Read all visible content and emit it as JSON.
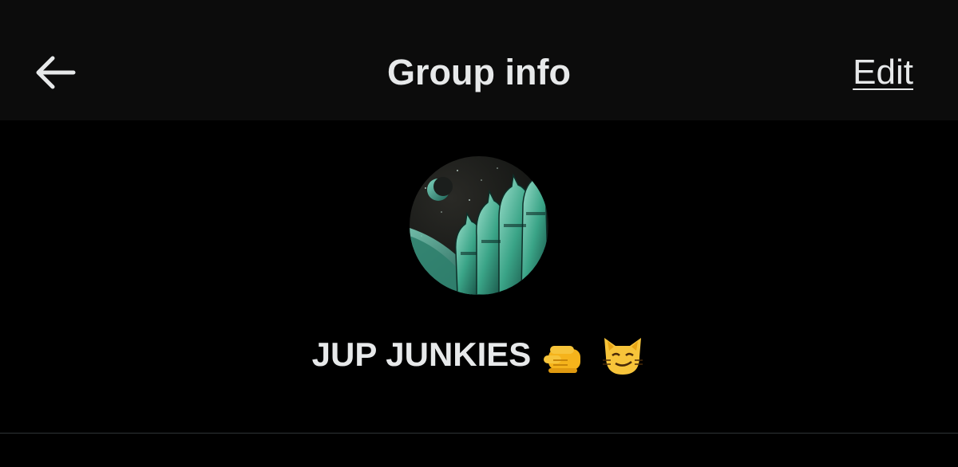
{
  "header": {
    "back_icon": "arrow-left-icon",
    "title": "Group info",
    "edit_label": "Edit"
  },
  "group": {
    "name": "JUP JUNKIES",
    "emojis": [
      "pointing-finger-icon",
      "smirking-cat-icon"
    ],
    "avatar_description": "space-cats-avatar"
  },
  "colors": {
    "background": "#000000",
    "header_background": "#0c0c0c",
    "text": "#e7e9ea",
    "divider": "#2f3336",
    "avatar_accent": "#2fa98f"
  }
}
